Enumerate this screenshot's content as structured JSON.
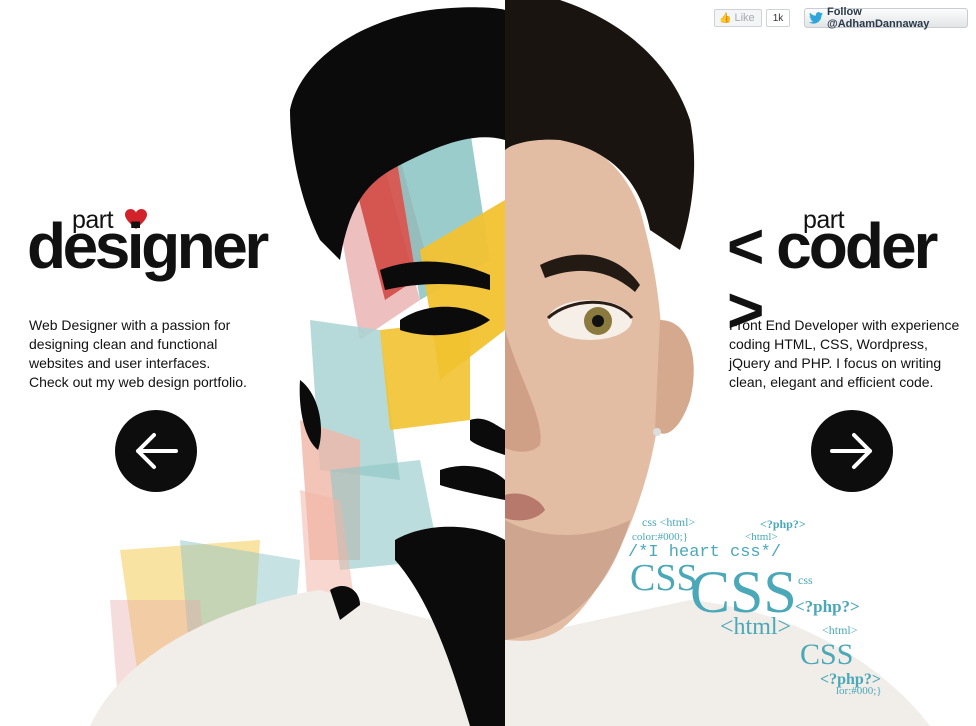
{
  "social": {
    "like_label": "Like",
    "like_count": "1k",
    "follow_label": "Follow @AdhamDannaway"
  },
  "designer": {
    "part_label": "part",
    "title": "designer",
    "line1": "Web Designer with a passion for",
    "line2": "designing clean and functional",
    "line3": "websites and user interfaces.",
    "line4": "Check out my web design portfolio."
  },
  "coder": {
    "part_label": "part",
    "title": "< coder >",
    "line1": "Front End Developer with experience",
    "line2": "coding HTML, CSS, Wordpress,",
    "line3": "jQuery and PHP. I focus on writing",
    "line4": "clean, elegant and efficient code."
  },
  "code_art": {
    "t1": "css <html>",
    "t2": "<?php?>",
    "t3": "color:#000;}",
    "t4": "<html>",
    "t5": "/*I heart css*/",
    "t6": "CSS",
    "t7": "CSS",
    "t8": "css",
    "t9": "<?php?>",
    "t10": "<html>",
    "t11": "<html>",
    "t12": "CSS",
    "t13": "<?php?>",
    "t14": "lor:#000;}"
  },
  "colors": {
    "accent_heart": "#d2232a",
    "code_teal": "#4aa8b8",
    "text_dark": "#111111"
  },
  "icons": {
    "left_arrow": "arrow-left-icon",
    "right_arrow": "arrow-right-icon",
    "heart": "heart-icon",
    "twitter": "twitter-bird-icon"
  }
}
